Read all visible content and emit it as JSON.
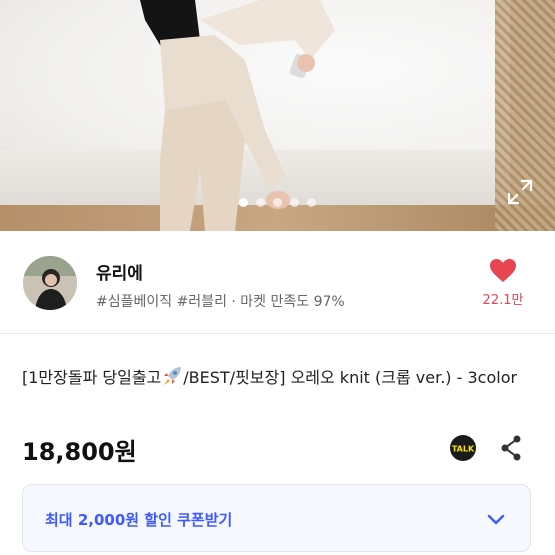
{
  "hero": {
    "slide_count": 5,
    "active_slide": 1
  },
  "seller": {
    "name": "유리에",
    "tags": "#심플베이직 #러블리 · 마켓 만족도 97%",
    "likes": "22.1만"
  },
  "product": {
    "title_part1": "[1만장돌파 당일출고",
    "title_part2": "/BEST/핏보장] 오레오 knit (크롭 ver.) - 3color",
    "price": "18,800원"
  },
  "coupon": {
    "label": "최대 2,000원 할인 쿠폰받기"
  },
  "icons": {
    "talk_label": "TALK"
  },
  "colors": {
    "accent": "#3d5afe",
    "heart": "#e64552"
  }
}
